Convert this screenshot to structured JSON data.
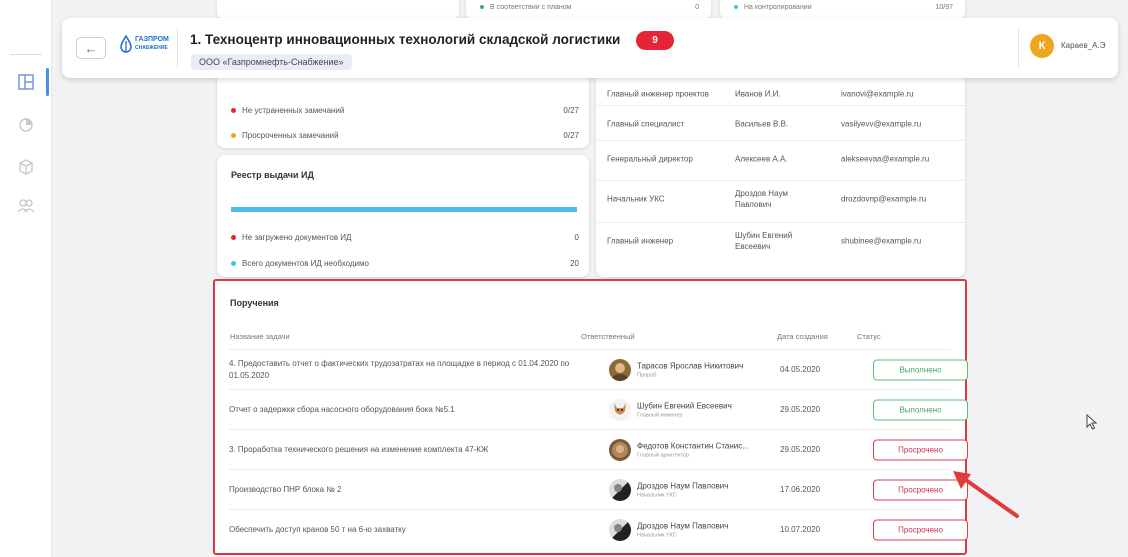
{
  "header": {
    "project_title": "1. Техноцентр инновационных технологий складской логистики",
    "badge_count": "9",
    "org": "ООО «Газпромнефть-Снабжение»",
    "logo_text_1": "ГАЗПРОМ",
    "logo_text_2": "СНАБЖЕНИЕ",
    "user_initial": "К",
    "user_name": "Караев_А.Э"
  },
  "top_strip": {
    "left_label": "В соответствии с планом",
    "left_value": "0",
    "right_label": "На контролировании",
    "right_value": "10/97"
  },
  "remarks": {
    "rows": [
      {
        "label": "Не устраненных замечаний",
        "value": "0/27",
        "color": "#e52436"
      },
      {
        "label": "Просроченных замечаний",
        "value": "0/27",
        "color": "#f0a51e"
      }
    ]
  },
  "registry": {
    "title": "Реестр выдачи ИД",
    "progress": 1.0,
    "rows": [
      {
        "label": "Не загружено документов ИД",
        "value": "0",
        "color": "#e52436"
      },
      {
        "label": "Всего документов ИД необходимо",
        "value": "20",
        "color": "#4bbde6"
      }
    ]
  },
  "contacts": [
    {
      "role": "Главный инженер проектов",
      "name": "Иванов И.И.",
      "email": "ivanovi@example.ru"
    },
    {
      "role": "Главный специалист",
      "name": "Васильев В.В.",
      "email": "vasilyevv@example.ru"
    },
    {
      "role": "Генеральный директор",
      "name": "Алексеев А.А.",
      "email": "alekseevaa@example.ru"
    },
    {
      "role": "Начальник УКС",
      "name": "Дроздов Наум Павлович",
      "email": "drozdovnp@example.ru"
    },
    {
      "role": "Главный инженер",
      "name": "Шубин Евгений Евсеевич",
      "email": "shubinee@example.ru"
    }
  ],
  "tasks": {
    "title": "Поручения",
    "headers": {
      "name": "Название задачи",
      "responsible": "Ответственный",
      "date": "Дата создания",
      "status": "Статус"
    },
    "rows": [
      {
        "name": "4. Предоставить отчет о фактических трудозатратах на площадке в период с 01.04.2020 по 01.05.2020",
        "person": "Тарасов Ярослав Никитович",
        "role": "Прораб",
        "date": "04.05.2020",
        "status": "Выполнено",
        "status_type": "done"
      },
      {
        "name": "Отчет о задержки сбора насосного оборудования бока №5.1",
        "person": "Шубин Евгений Евсеевич",
        "role": "Главный инженер",
        "date": "29.05.2020",
        "status": "Выполнено",
        "status_type": "done"
      },
      {
        "name": "3. Проработка технического решения на изменение комплекта 47-КЖ",
        "person": "Федотов Константин Станис...",
        "role": "Главный архитектор",
        "date": "29.05.2020",
        "status": "Просрочено",
        "status_type": "late"
      },
      {
        "name": "Производство ПНР блока № 2",
        "person": "Дроздов Наум Павлович",
        "role": "Начальник УКС",
        "date": "17.06.2020",
        "status": "Просрочено",
        "status_type": "late"
      },
      {
        "name": "Обеспечить доступ кранов 50 т на 6-ю захватку",
        "person": "Дроздов Наум Павлович",
        "role": "Начальник УКС",
        "date": "10.07.2020",
        "status": "Просрочено",
        "status_type": "late"
      }
    ]
  },
  "sidebar": {
    "icons": [
      "dashboard-icon",
      "chart-icon",
      "cube-icon",
      "users-icon"
    ]
  }
}
